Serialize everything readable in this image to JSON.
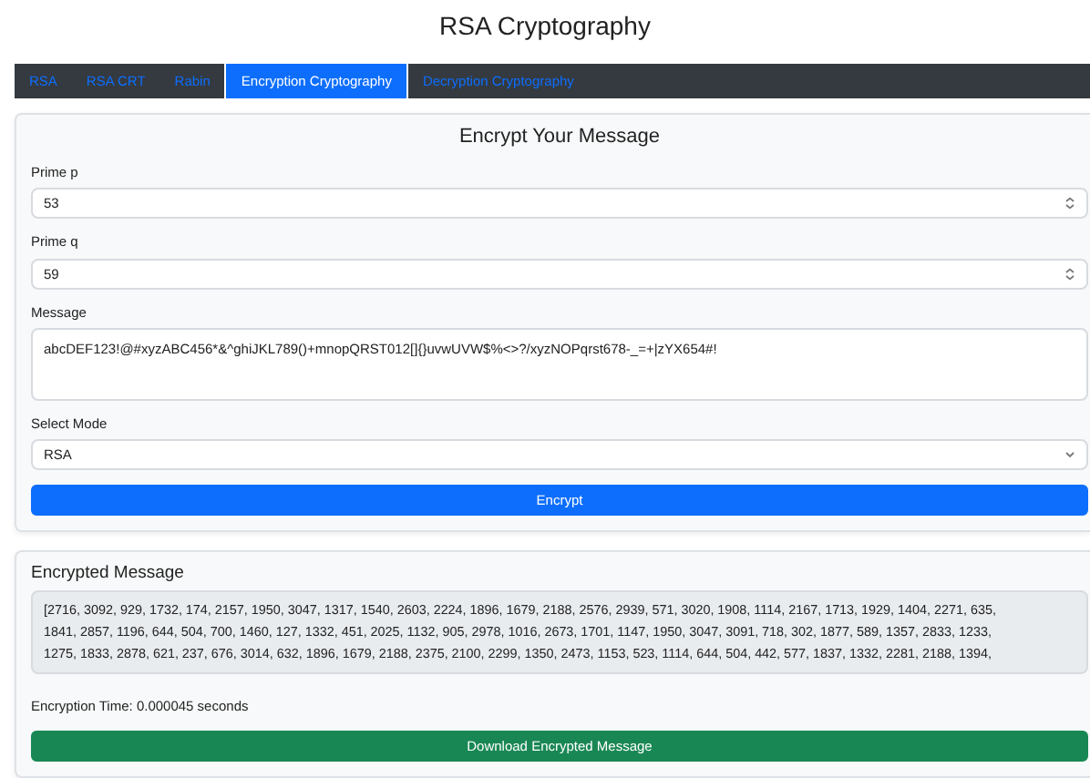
{
  "title": "RSA Cryptography",
  "tabs": [
    {
      "label": "RSA",
      "selected": false
    },
    {
      "label": "RSA CRT",
      "selected": false
    },
    {
      "label": "Rabin",
      "selected": false
    },
    {
      "label": "Encryption Cryptography",
      "selected": true
    },
    {
      "label": "Decryption Cryptography",
      "selected": false
    }
  ],
  "encrypt_form": {
    "heading": "Encrypt Your Message",
    "prime_p": {
      "label": "Prime p",
      "value": "53"
    },
    "prime_q": {
      "label": "Prime q",
      "value": "59"
    },
    "message": {
      "label": "Message",
      "value": "abcDEF123!@#xyzABC456*&^ghiJKL789()+mnopQRST012[]{}uvwUVW$%<>?/xyzNOPqrst678-_=+|zYX654#!"
    },
    "mode": {
      "label": "Select Mode",
      "value": "RSA"
    },
    "button": "Encrypt"
  },
  "result": {
    "heading": "Encrypted Message",
    "lines": [
      "[2716, 3092, 929, 1732, 174, 2157, 1950, 3047, 1317, 1540, 2603, 2224, 1896, 1679, 2188, 2576, 2939, 571, 3020, 1908, 1114, 2167, 1713, 1929, 1404, 2271, 635,",
      "1841, 2857, 1196, 644, 504, 700, 1460, 127, 1332, 451, 2025, 1132, 905, 2978, 1016, 2673, 1701, 1147, 1950, 3047, 3091, 718, 302, 1877, 589, 1357, 2833, 1233,",
      "1275, 1833, 2878, 621, 237, 676, 3014, 632, 1896, 1679, 2188, 2375, 2100, 2299, 1350, 2473, 1153, 523, 1114, 644, 504, 442, 577, 1837, 1332, 2281, 2188, 1394,"
    ],
    "time": "Encryption Time: 0.000045 seconds",
    "button": "Download Encrypted Message"
  }
}
